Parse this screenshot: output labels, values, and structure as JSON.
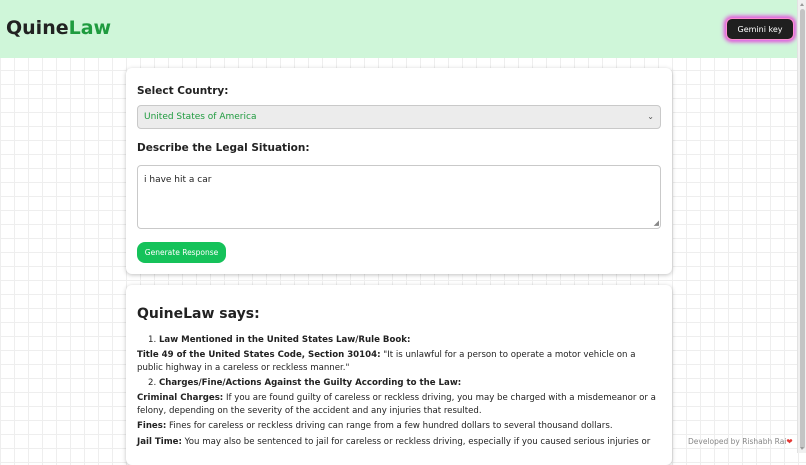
{
  "header": {
    "logo_part1": "Quine",
    "logo_part2": "Law",
    "gemini_button": "Gemini key",
    "bg_color": "#cff6d9",
    "accent_color": "#1f9b3f"
  },
  "form": {
    "country_label": "Select Country:",
    "country_value": "United States of America",
    "situation_label": "Describe the Legal Situation:",
    "situation_value": "i have hit a car",
    "generate_button": "Generate Response",
    "button_color": "#15c25a"
  },
  "result": {
    "title": "QuineLaw says:",
    "item1_number": "1.",
    "item1_heading": "Law Mentioned in the United States Law/Rule Book:",
    "title49_bold": "Title 49 of the United States Code, Section 30104:",
    "title49_text": " \"It is unlawful for a person to operate a motor vehicle on a public highway in a careless or reckless manner.\"",
    "item2_number": "2.",
    "item2_heading": "Charges/Fine/Actions Against the Guilty According to the Law:",
    "criminal_bold": "Criminal Charges:",
    "criminal_text": " If you are found guilty of careless or reckless driving, you may be charged with a misdemeanor or a felony, depending on the severity of the accident and any injuries that resulted.",
    "fines_bold": "Fines:",
    "fines_text": " Fines for careless or reckless driving can range from a few hundred dollars to several thousand dollars.",
    "jail_bold": "Jail Time:",
    "jail_text": " You may also be sentenced to jail for careless or reckless driving, especially if you caused serious injuries or"
  },
  "footer": {
    "text": "Developed by Rishabh Rai",
    "heart_icon": "heart-icon"
  }
}
